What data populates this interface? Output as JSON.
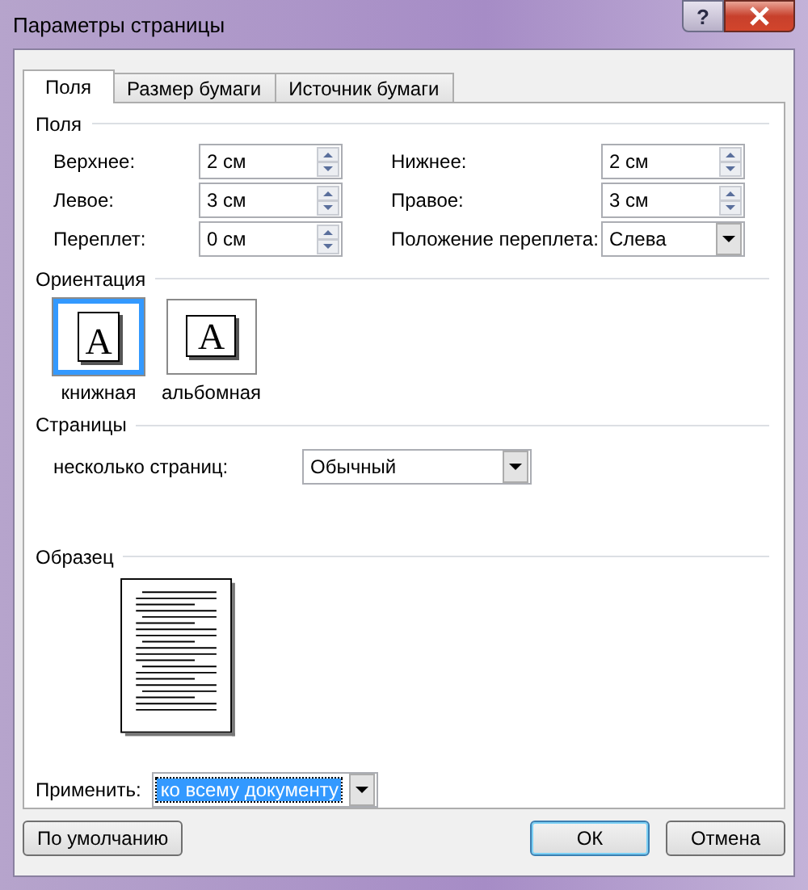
{
  "window": {
    "title": "Параметры страницы",
    "help_button": "?"
  },
  "tabs": [
    {
      "label": "Поля",
      "selected": true
    },
    {
      "label": "Размер бумаги",
      "selected": false
    },
    {
      "label": "Источник бумаги",
      "selected": false
    }
  ],
  "margins": {
    "heading": "Поля",
    "fields": [
      {
        "label": "Верхнее:",
        "value": "2 см",
        "kind": "spin"
      },
      {
        "label": "Нижнее:",
        "value": "2 см",
        "kind": "spin"
      },
      {
        "label": "Левое:",
        "value": "3 см",
        "kind": "spin"
      },
      {
        "label": "Правое:",
        "value": "3 см",
        "kind": "spin"
      },
      {
        "label": "Переплет:",
        "value": "0 см",
        "kind": "spin"
      },
      {
        "label": "Положение переплета:",
        "value": "Слева",
        "kind": "dropdown"
      }
    ]
  },
  "orientation": {
    "heading": "Ориентация",
    "options": [
      {
        "label": "книжная",
        "icon_letter": "A",
        "kind": "portrait",
        "selected": true
      },
      {
        "label": "альбомная",
        "icon_letter": "A",
        "kind": "landscape",
        "selected": false
      }
    ]
  },
  "pages": {
    "heading": "Страницы",
    "label": "несколько страниц:",
    "value": "Обычный"
  },
  "sample": {
    "heading": "Образец"
  },
  "apply": {
    "label": "Применить:",
    "value": "ко всему документу",
    "focused": true
  },
  "buttons": [
    {
      "label": "По умолчанию",
      "default": false,
      "kind": "left"
    },
    {
      "label": "ОК",
      "default": true,
      "kind": "right"
    },
    {
      "label": "Отмена",
      "default": false,
      "kind": "right"
    }
  ]
}
